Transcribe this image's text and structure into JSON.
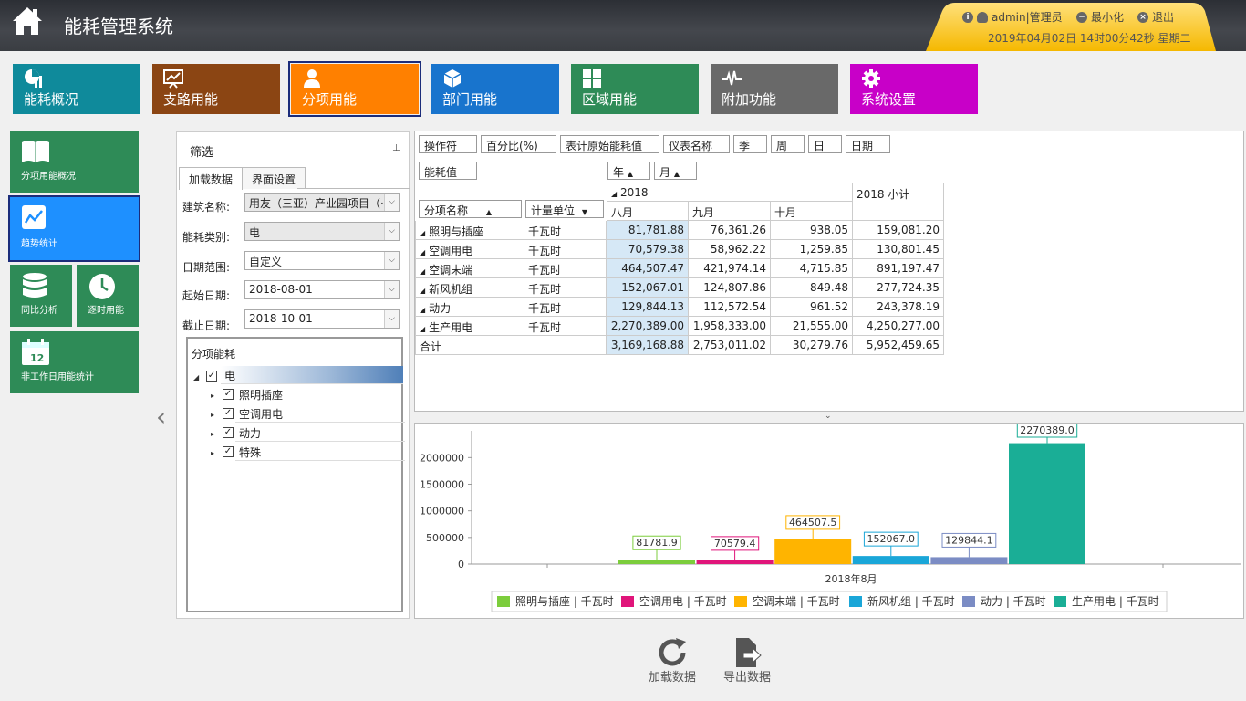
{
  "app": {
    "title": "能耗管理系统"
  },
  "user": {
    "name": "admin|管理员",
    "minimize": "最小化",
    "logout": "退出",
    "datetime": "2019年04月02日 14时00分42秒 星期二"
  },
  "nav": [
    {
      "label": "能耗概况",
      "color": "#0f8a9b"
    },
    {
      "label": "支路用能",
      "color": "#8b4513"
    },
    {
      "label": "分项用能",
      "color": "#ff8000"
    },
    {
      "label": "部门用能",
      "color": "#1874cd"
    },
    {
      "label": "区域用能",
      "color": "#2e8b57"
    },
    {
      "label": "附加功能",
      "color": "#696969"
    },
    {
      "label": "系统设置",
      "color": "#c800c8"
    }
  ],
  "side": {
    "overview": "分项用能概况",
    "trend": "趋势统计",
    "yoy": "同比分析",
    "hourly": "逐时用能",
    "nonwork": "非工作日用能统计",
    "calendar_num": "12"
  },
  "filter": {
    "title": "筛选",
    "tabs": [
      "加载数据",
      "界面设置"
    ],
    "building_label": "建筑名称:",
    "building_value": "用友（三亚）产业园项目（·",
    "type_label": "能耗类别:",
    "type_value": "电",
    "range_label": "日期范围:",
    "range_value": "自定义",
    "start_label": "起始日期:",
    "start_value": "2018-08-01",
    "end_label": "截止日期:",
    "end_value": "2018-10-01",
    "tree_title": "分项能耗",
    "tree_root": "电",
    "tree_children": [
      "照明插座",
      "空调用电",
      "动力",
      "特殊"
    ]
  },
  "pivot": {
    "fields": [
      "操作符",
      "百分比(%)",
      "表计原始能耗值",
      "仪表名称",
      "季",
      "周",
      "日",
      "日期"
    ],
    "data_field": "能耗值",
    "col_fields": [
      "年",
      "月"
    ],
    "row_fields": [
      "分项名称",
      "计量单位"
    ],
    "year": "2018",
    "subtotal": "2018 小计",
    "months": [
      "八月",
      "九月",
      "十月"
    ],
    "rows": [
      {
        "name": "照明与插座",
        "unit": "千瓦时",
        "values": [
          "81,781.88",
          "76,361.26",
          "938.05",
          "159,081.20"
        ]
      },
      {
        "name": "空调用电",
        "unit": "千瓦时",
        "values": [
          "70,579.38",
          "58,962.22",
          "1,259.85",
          "130,801.45"
        ]
      },
      {
        "name": "空调末端",
        "unit": "千瓦时",
        "values": [
          "464,507.47",
          "421,974.14",
          "4,715.85",
          "891,197.47"
        ]
      },
      {
        "name": "新风机组",
        "unit": "千瓦时",
        "values": [
          "152,067.01",
          "124,807.86",
          "849.48",
          "277,724.35"
        ]
      },
      {
        "name": "动力",
        "unit": "千瓦时",
        "values": [
          "129,844.13",
          "112,572.54",
          "961.52",
          "243,378.19"
        ]
      },
      {
        "name": "生产用电",
        "unit": "千瓦时",
        "values": [
          "2,270,389.00",
          "1,958,333.00",
          "21,555.00",
          "4,250,277.00"
        ]
      }
    ],
    "total_label": "合计",
    "totals": [
      "3,169,168.88",
      "2,753,011.02",
      "30,279.76",
      "5,952,459.65"
    ]
  },
  "chart_data": {
    "type": "bar",
    "categories": [
      "2018年8月"
    ],
    "series": [
      {
        "name": "照明与插座 | 千瓦时",
        "values": [
          81781.9
        ],
        "label": "81781.9",
        "color": "#7ccd3c"
      },
      {
        "name": "空调用电 | 千瓦时",
        "values": [
          70579.4
        ],
        "label": "70579.4",
        "color": "#e0157a"
      },
      {
        "name": "空调末端 | 千瓦时",
        "values": [
          464507.5
        ],
        "label": "464507.5",
        "color": "#ffb400"
      },
      {
        "name": "新风机组 | 千瓦时",
        "values": [
          152067.0
        ],
        "label": "152067.0",
        "color": "#1aa6d8"
      },
      {
        "name": "动力 | 千瓦时",
        "values": [
          129844.1
        ],
        "label": "129844.1",
        "color": "#7b8cc4"
      },
      {
        "name": "生产用电 | 千瓦时",
        "values": [
          2270389.0
        ],
        "label": "2270389.0",
        "color": "#1aae96"
      }
    ],
    "yticks": [
      "0",
      "500000",
      "1000000",
      "1500000",
      "2000000"
    ],
    "ylim": [
      0,
      2400000
    ],
    "legend": "bottom",
    "grid": false
  },
  "buttons": {
    "load": "加载数据",
    "export": "导出数据"
  }
}
